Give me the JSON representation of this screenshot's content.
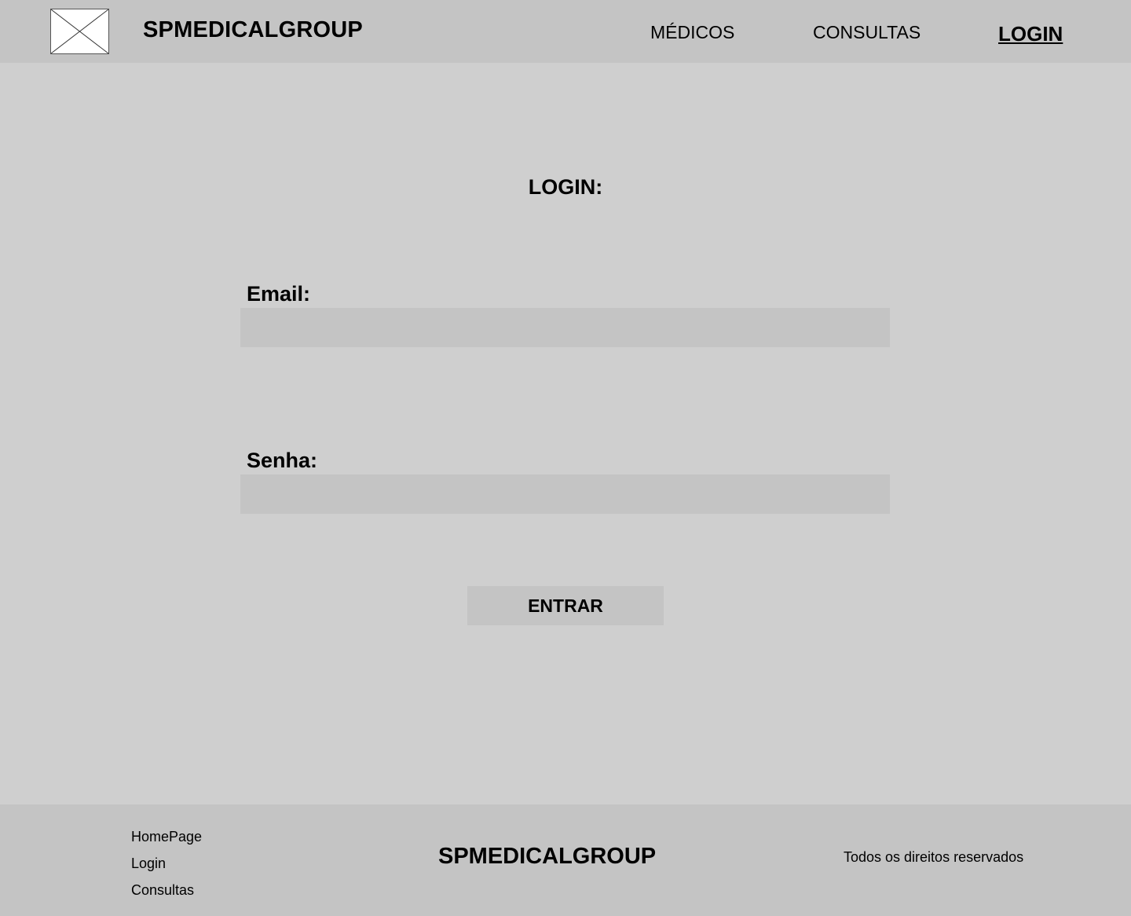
{
  "header": {
    "logo_icon": "image-placeholder-icon",
    "brand": "SPMEDICALGROUP",
    "nav": {
      "medicos": "MÉDICOS",
      "consultas": "CONSULTAS",
      "login": "LOGIN"
    }
  },
  "form": {
    "title": "LOGIN:",
    "email_label": "Email:",
    "email_value": "",
    "senha_label": "Senha:",
    "senha_value": "",
    "submit_label": "ENTRAR"
  },
  "footer": {
    "links": {
      "homepage": "HomePage",
      "login": "Login",
      "consultas": "Consultas"
    },
    "brand": "SPMEDICALGROUP",
    "rights": "Todos os direitos reservados"
  },
  "colors": {
    "header_bg": "#c4c4c4",
    "page_bg": "#cfcfcf",
    "input_bg": "#c4c4c4",
    "text": "#000000"
  }
}
